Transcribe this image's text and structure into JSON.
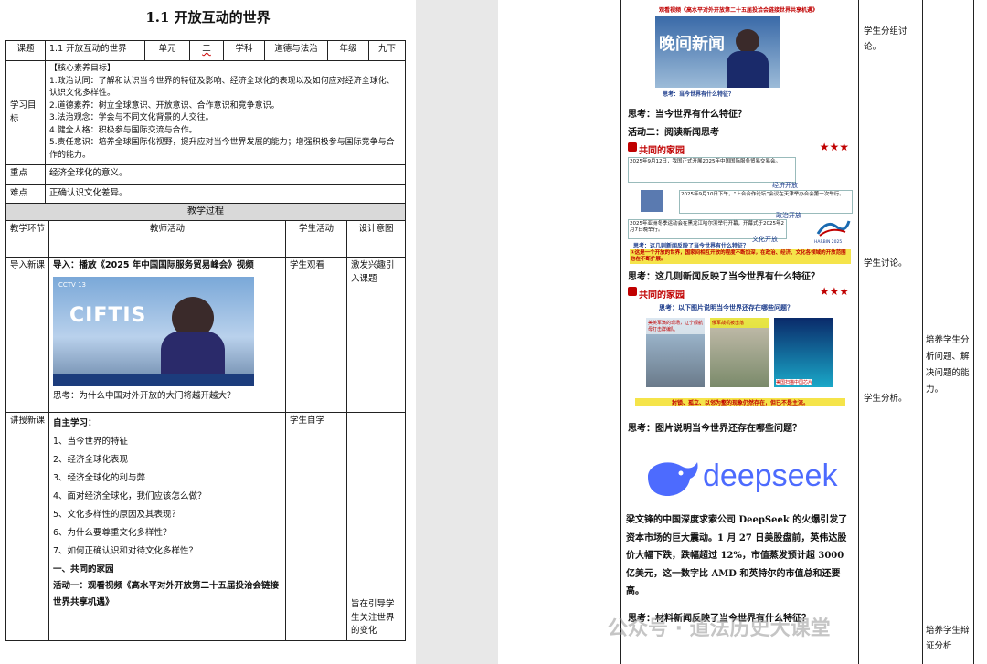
{
  "left": {
    "title": "1.1 开放互动的世界",
    "info_row": {
      "topic_label": "课题",
      "topic_value": "1.1 开放互动的世界",
      "unit_label": "单元",
      "unit_value": "二",
      "subject_label": "学科",
      "subject_value": "道德与法治",
      "grade_label": "年级",
      "grade_value": "九下"
    },
    "goals_label": "学习目标",
    "goals": [
      "【核心素养目标】",
      "1.政治认同：了解和认识当今世界的特征及影响、经济全球化的表现以及如何应对经济全球化、认识文化多样性。",
      "2.道德素养：树立全球意识、开放意识、合作意识和竞争意识。",
      "3.法治观念：学会与不同文化背景的人交往。",
      "4.健全人格：积极参与国际交流与合作。",
      "5.责任意识：培养全球国际化视野，提升应对当今世界发展的能力；增强积极参与国际竞争与合作的能力。"
    ],
    "key_label": "重点",
    "key_value": "经济全球化的意义。",
    "diff_label": "难点",
    "diff_value": "正确认识文化差异。",
    "process_label": "教学过程",
    "col_headers": [
      "教学环节",
      "教师活动",
      "学生活动",
      "设计意图"
    ],
    "intro": {
      "stage": "导入新课",
      "activity_title": "导入：播放《2025 年中国国际服务贸易峰会》视频",
      "video_logo": "CIFTIS",
      "video_tag": "CCTV 13",
      "question": "思考：为什么中国对外开放的大门将越开越大？",
      "student": "学生观看",
      "intent": "激发兴趣引入课题"
    },
    "lecture": {
      "stage": "讲授新课",
      "subtitle": "自主学习：",
      "items": [
        "1、当今世界的特征",
        "2、经济全球化表现",
        "3、经济全球化的利与弊",
        "4、面对经济全球化，我们应该怎么做？",
        "5、文化多样性的原因及其表现？",
        "6、为什么要尊重文化多样性？",
        "7、如何正确认识和对待文化多样性？"
      ],
      "section": "一、共同的家园",
      "activity": "活动一：观看视频《高水平对外开放第二十五届投洽会链接世界共享机遇》",
      "student": "学生自学",
      "intent": "旨在引导学生关注世界的变化"
    }
  },
  "right": {
    "video_caption": "观看视频《高水平对外开放第二十五届投洽会链接世界共享机遇》",
    "video_title": "晚间新闻",
    "video_sub": "思考：当今世界有什么特征？",
    "q1": "思考：当今世界有什么特征？",
    "activity2": "活动二：阅读新闻思考",
    "news1": {
      "header": "共同的家园",
      "stars": "★★★",
      "items": [
        {
          "text": "2025年9月12日，我国正式开展2025年中国国际服务贸易交易会。",
          "tag": "经济开放"
        },
        {
          "text": "2025年9月10日下午，“上合合作论坛”会议在天津举办合会第一次举行。",
          "tag": "政治开放"
        },
        {
          "text": "2025年亚洲冬季运动会在黑龙江哈尔滨举行开幕，开幕式于2025年2月7日晚举行。",
          "tag": "文化开放"
        }
      ],
      "logo_text": "HARBIN 2025",
      "question": "思考：这几则新闻反映了当今世界有什么特征？",
      "answer": "①这是一个开放的世界，国家间相互开放的程度不断加深，在政治、经济、文化各领域的开放范围也在不断扩展。"
    },
    "q2": "思考：这几则新闻反映了当今世界有什么特征？",
    "news2": {
      "header": "共同的家园",
      "stars": "★★★",
      "question": "思考：以下图片说明当今世界还存在哪些问题？",
      "img1_text": "美英军演的现场，辽宁舰航母打击群编队",
      "img2_text": "俄军战机被击落",
      "img3_text": "美国扫描中国芯片",
      "answer": "封锁、孤立、以邻为壑的现象仍然存在，但已不是主流。"
    },
    "q3": "思考：图片说明当今世界还存在哪些问题？",
    "brand": "deepseek",
    "paragraph": "梁文锋的中国深度求索公司 DeepSeek 的火爆引发了资本市场的巨大震动。1 月 27 日美股盘前，英伟达股价大幅下跌，跌幅超过 12%，市值蒸发预计超 3000 亿美元，这一数字比 AMD 和英特尔的市值总和还要高。",
    "q4": "思考：材料新闻反映了当今世界有什么特征？",
    "student_col": [
      "学生分组讨论。",
      "学生讨论。",
      "学生分析。"
    ],
    "intent_col": [
      "培养学生分析问题、解决问题的能力。",
      "培养学生辩证分析"
    ],
    "watermark": "公众号 · 道法历史大课堂"
  }
}
